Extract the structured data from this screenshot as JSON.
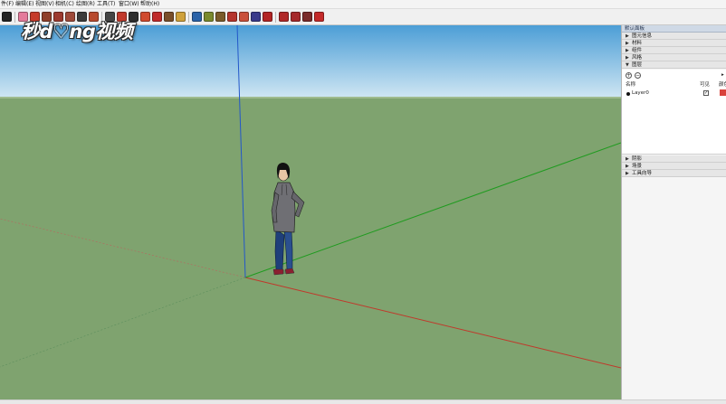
{
  "menu": {
    "items": [
      "件(F)",
      "编辑(E)",
      "视图(V)",
      "相机(C)",
      "绘图(R)",
      "工具(T)",
      "窗口(W)",
      "帮助(H)"
    ]
  },
  "toolbar": {
    "icons": [
      {
        "name": "select-arrow-icon",
        "color": "#222222"
      },
      {
        "name": "eraser-icon",
        "color": "#e47b9b"
      },
      {
        "name": "line-pencil-icon",
        "color": "#c53b2a"
      },
      {
        "name": "freehand-icon",
        "color": "#8f3f2a"
      },
      {
        "name": "rectangle-icon",
        "color": "#9c3a2f"
      },
      {
        "name": "circle-icon",
        "color": "#9e4a3a"
      },
      {
        "name": "arc-icon",
        "color": "#3b3b3b"
      },
      {
        "name": "paint-bucket-icon",
        "color": "#b84a2e"
      },
      {
        "name": "push-pull-icon",
        "color": "#444444"
      },
      {
        "name": "move-icon",
        "color": "#c0392b"
      },
      {
        "name": "rotate-icon",
        "color": "#2e2e2e"
      },
      {
        "name": "scale-icon",
        "color": "#d04a2e"
      },
      {
        "name": "offset-icon",
        "color": "#c02b2b"
      },
      {
        "name": "follow-me-icon",
        "color": "#7a4f2a"
      },
      {
        "name": "tape-measure-icon",
        "color": "#cfa13b"
      },
      {
        "name": "text-label-icon",
        "color": "#2b63a8"
      },
      {
        "name": "axes-icon",
        "color": "#7a8a2e"
      },
      {
        "name": "section-plane-icon",
        "color": "#7a5a2a"
      },
      {
        "name": "orbit-icon",
        "color": "#b5342c"
      },
      {
        "name": "pan-hand-icon",
        "color": "#c9503a"
      },
      {
        "name": "zoom-icon",
        "color": "#3a3a8a"
      },
      {
        "name": "zoom-extents-icon",
        "color": "#b32424"
      },
      {
        "name": "warehouse-icon",
        "color": "#b02828"
      },
      {
        "name": "extension-icon",
        "color": "#a5282a"
      },
      {
        "name": "share-model-icon",
        "color": "#7a2a2a"
      },
      {
        "name": "ruby-icon",
        "color": "#c42a2a"
      }
    ]
  },
  "watermark": {
    "text": "秒d♡ng视频"
  },
  "viewport": {
    "sky_color": "#4ea3d8",
    "ground_color": "#7fa36f",
    "axis_colors": {
      "red": "#c0392b",
      "green": "#1f9b1f",
      "blue": "#2357c9"
    }
  },
  "panel": {
    "title": "默认面板",
    "sections_top": [
      {
        "label": "图元信息",
        "expanded": false
      },
      {
        "label": "材料",
        "expanded": false
      },
      {
        "label": "组件",
        "expanded": false
      },
      {
        "label": "风格",
        "expanded": false
      },
      {
        "label": "图层",
        "expanded": true
      }
    ],
    "layers": {
      "col_name": "名称",
      "col_visible": "可见",
      "col_color": "颜色",
      "rows": [
        {
          "name": "Layer0",
          "visible": true,
          "color": "#d9413b"
        }
      ]
    },
    "sections_bottom": [
      {
        "label": "阴影",
        "expanded": false
      },
      {
        "label": "场景",
        "expanded": false
      },
      {
        "label": "工具向导",
        "expanded": false
      }
    ]
  }
}
